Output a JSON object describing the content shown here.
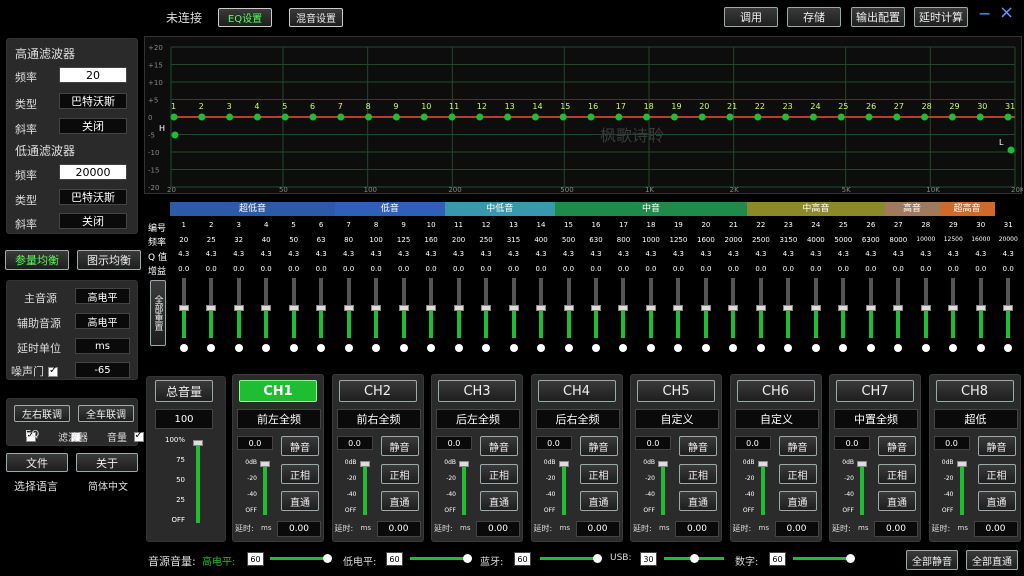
{
  "top": {
    "status": "未连接",
    "tab_eq": "EQ设置",
    "tab_mix": "混音设置",
    "btn_call": "调用",
    "btn_save": "存储",
    "btn_output": "输出配置",
    "btn_delay": "延时计算",
    "minimize": "−",
    "close": "×"
  },
  "filters": {
    "hp_title": "高通滤波器",
    "hp_freq_label": "频率",
    "hp_freq": "20",
    "hp_type_label": "类型",
    "hp_type": "巴特沃斯",
    "hp_slope_label": "斜率",
    "hp_slope": "关闭",
    "lp_title": "低通滤波器",
    "lp_freq_label": "频率",
    "lp_freq": "20000",
    "lp_type_label": "类型",
    "lp_type": "巴特沃斯",
    "lp_slope_label": "斜率",
    "lp_slope": "关闭"
  },
  "mode": {
    "param": "参量均衡",
    "graphic": "图示均衡"
  },
  "source": {
    "main_label": "主音源",
    "main_value": "高电平",
    "aux_label": "辅助音源",
    "aux_value": "高电平",
    "delay_unit_label": "延时单位",
    "delay_unit_value": "ms",
    "gate_label": "噪声门",
    "gate_value": "-65"
  },
  "link": {
    "lr": "左右联调",
    "all": "全车联调",
    "eq": "EQ",
    "filter": "滤波器",
    "volume": "音量",
    "file": "文件",
    "about": "关于",
    "lang_label": "选择语言",
    "lang_value": "简体中文"
  },
  "graph": {
    "y_ticks": [
      "+20",
      "+15",
      "+10",
      "+5",
      "0",
      "-5",
      "-10",
      "-15",
      "-20"
    ],
    "x_ticks": [
      "20",
      "50",
      "100",
      "200",
      "500",
      "1K",
      "2K",
      "5K",
      "10K",
      "20K"
    ],
    "h_marker": "H",
    "l_marker": "L",
    "watermark": "枫歌诗聆"
  },
  "bands": [
    {
      "name": "超低音",
      "color": "#2d5aa6"
    },
    {
      "name": "低音",
      "color": "#2e60b8"
    },
    {
      "name": "中低音",
      "color": "#3a98ad"
    },
    {
      "name": "中音",
      "color": "#1f8a4a"
    },
    {
      "name": "中高音",
      "color": "#8a8a2a"
    },
    {
      "name": "高音",
      "color": "#a07a5a"
    },
    {
      "name": "超高音",
      "color": "#d06a2a"
    }
  ],
  "eq_labels": {
    "num": "编号",
    "freq": "频率",
    "q": "Q 值",
    "gain": "增益",
    "reset": "全部重置"
  },
  "eq_freqs": [
    "20",
    "25",
    "32",
    "40",
    "50",
    "63",
    "80",
    "100",
    "125",
    "160",
    "200",
    "250",
    "315",
    "400",
    "500",
    "630",
    "800",
    "1000",
    "1250",
    "1600",
    "2000",
    "2500",
    "3150",
    "4000",
    "5000",
    "6300",
    "8000",
    "10000",
    "12500",
    "16000",
    "20000"
  ],
  "eq_q": "4.3",
  "eq_gain": "0.0",
  "master": {
    "label": "总音量",
    "value": "100",
    "ticks": [
      "100%",
      "75",
      "50",
      "25",
      "OFF"
    ]
  },
  "channels": [
    {
      "id": "CH1",
      "name": "前左全频"
    },
    {
      "id": "CH2",
      "name": "前右全频"
    },
    {
      "id": "CH3",
      "name": "后左全频"
    },
    {
      "id": "CH4",
      "name": "后右全频"
    },
    {
      "id": "CH5",
      "name": "自定义"
    },
    {
      "id": "CH6",
      "name": "自定义"
    },
    {
      "id": "CH7",
      "name": "中置全频"
    },
    {
      "id": "CH8",
      "name": "超低"
    }
  ],
  "ch_common": {
    "level": "0.0",
    "mute": "静音",
    "phase": "正相",
    "direct": "直通",
    "delay_label": "延时:",
    "delay_unit": "ms",
    "delay_value": "0.00",
    "ticks": [
      "0dB",
      "-20",
      "-40",
      "OFF"
    ]
  },
  "bottom": {
    "label": "音源音量:",
    "hi_label": "高电平:",
    "hi_val": "60",
    "lo_label": "低电平:",
    "lo_val": "60",
    "bt_label": "蓝牙:",
    "bt_val": "60",
    "usb_label": "USB:",
    "usb_val": "30",
    "dig_label": "数字:",
    "dig_val": "60",
    "mute_all": "全部静音",
    "direct_all": "全部直通"
  },
  "colors": {
    "accent": "#1fbe32",
    "line": "#c0392b"
  }
}
